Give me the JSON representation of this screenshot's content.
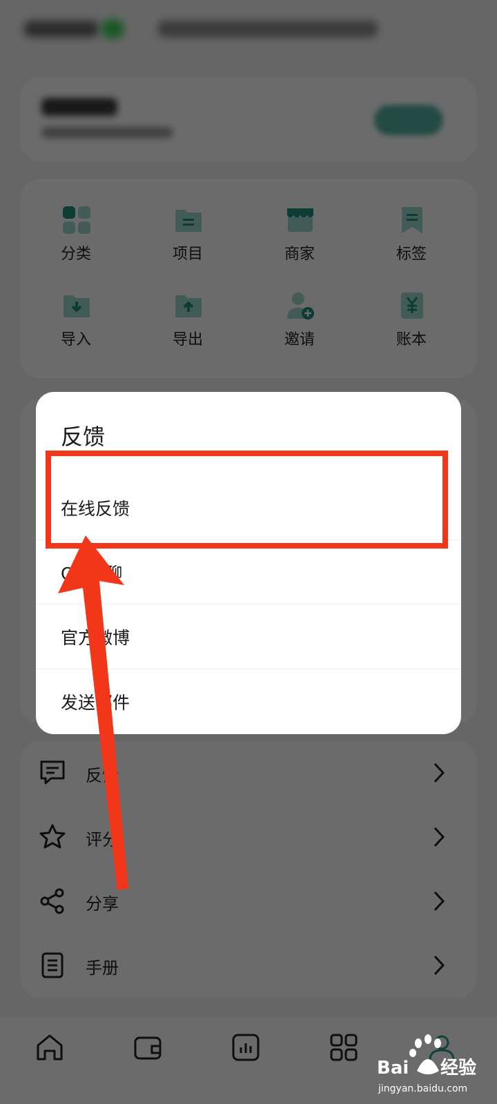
{
  "colors": {
    "accent": "#2e9e8c",
    "overlay": "rgba(0,0,0,0.58)",
    "highlight": "#f2361a"
  },
  "grid": {
    "items": [
      {
        "label": "分类",
        "icon": "category-icon"
      },
      {
        "label": "项目",
        "icon": "project-folder-icon"
      },
      {
        "label": "商家",
        "icon": "store-icon"
      },
      {
        "label": "标签",
        "icon": "tag-icon"
      },
      {
        "label": "导入",
        "icon": "import-icon"
      },
      {
        "label": "导出",
        "icon": "export-icon"
      },
      {
        "label": "邀请",
        "icon": "invite-user-icon"
      },
      {
        "label": "账本",
        "icon": "ledger-icon"
      }
    ]
  },
  "list": {
    "items": [
      {
        "label": "反馈",
        "icon": "feedback-icon"
      },
      {
        "label": "评分",
        "icon": "star-icon"
      },
      {
        "label": "分享",
        "icon": "share-icon"
      },
      {
        "label": "手册",
        "icon": "manual-icon"
      }
    ]
  },
  "dialog": {
    "title": "反馈",
    "options": [
      "在线反馈",
      "QQ群聊",
      "官方微博",
      "发送邮件"
    ]
  },
  "tabbar": {
    "tabs": [
      "home-icon",
      "wallet-icon",
      "chart-icon",
      "apps-icon",
      "profile-icon"
    ]
  },
  "watermark": {
    "brand": "Bai du 经验",
    "url": "jingyan.baidu.com"
  }
}
